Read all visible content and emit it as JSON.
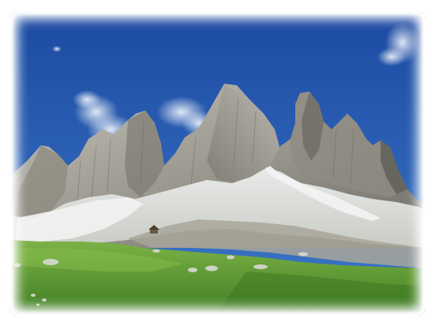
{
  "photo": {
    "subject": "mountain-landscape",
    "palette": {
      "sky_top": "#1f4fa8",
      "sky_bottom": "#3a73c4",
      "rock_light": "#b8b6ad",
      "rock_mid": "#8f8c83",
      "rock_dark": "#5f5d57",
      "snow": "#eef0f0",
      "grass_light": "#6fa83a",
      "grass_dark": "#3f7a22",
      "cloud": "#ffffff"
    },
    "frame_style": "soft-white-vignette"
  }
}
